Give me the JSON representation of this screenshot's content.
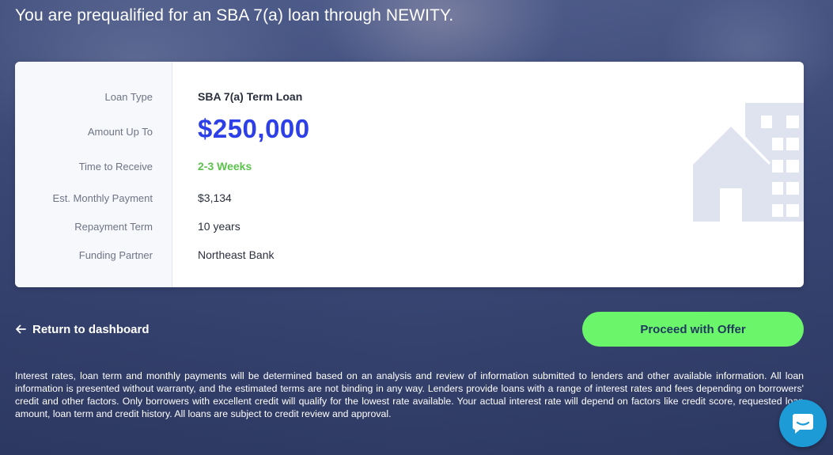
{
  "header": {
    "subtitle": "You are prequalified for an SBA 7(a) loan through NEWITY."
  },
  "offer": {
    "labels": {
      "loan_type": "Loan Type",
      "amount": "Amount Up To",
      "time": "Time to Receive",
      "payment": "Est. Monthly Payment",
      "term": "Repayment Term",
      "partner": "Funding Partner"
    },
    "values": {
      "loan_type": "SBA 7(a) Term Loan",
      "amount": "$250,000",
      "time": "2-3 Weeks",
      "payment": "$3,134",
      "term": "10 years",
      "partner": "Northeast Bank"
    },
    "illustration_icon": "building-icon"
  },
  "actions": {
    "return_label": "Return to dashboard",
    "return_icon": "arrow-left-icon",
    "proceed_label": "Proceed with Offer"
  },
  "disclaimer": "Interest rates, loan term and monthly payments will be determined based on an analysis and review of information submitted to lenders and other available information. All loan information is presented without warranty, and the estimated terms are not binding in any way. Lenders provide loans with a range of interest rates and fees depending on borrowers' credit and other factors. Only borrowers with excellent credit will qualify for the lowest rate available. Your actual interest rate will depend on factors like credit score, requested loan amount, loan term and credit history. All loans are subject to credit review and approval.",
  "chat": {
    "icon": "chat-icon"
  },
  "colors": {
    "accent_blue": "#2d3fe6",
    "time_green": "#5bc24c",
    "button_green": "#6bf56b",
    "chat_blue": "#1c9bd7"
  }
}
